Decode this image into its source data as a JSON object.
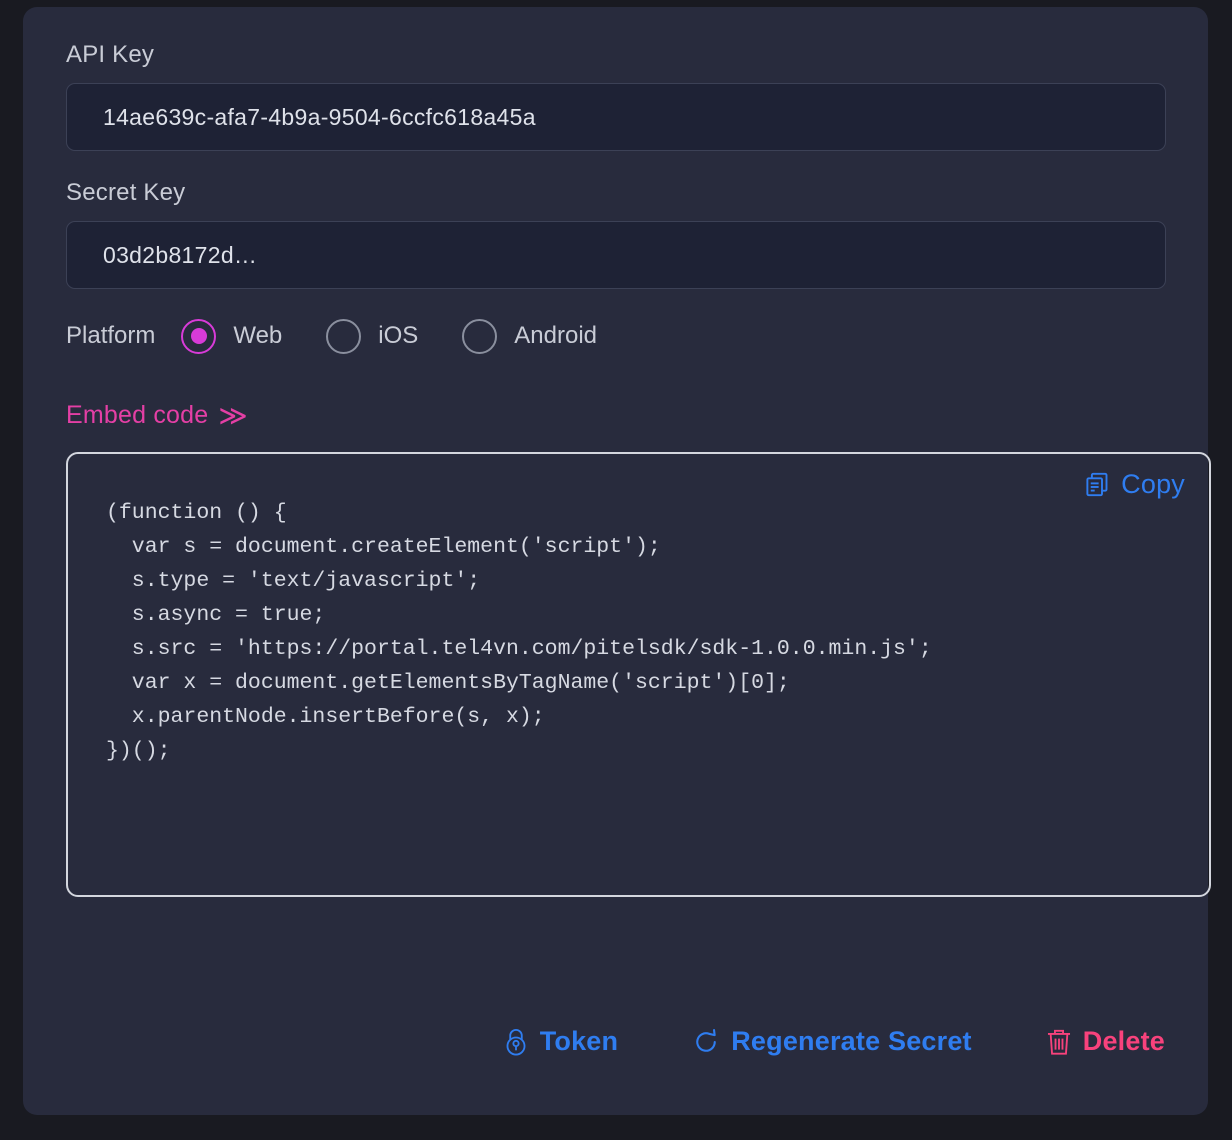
{
  "theme": {
    "page_background": "#191a21",
    "card_background": "#282b3d",
    "input_background": "#1e2235",
    "label_color": "#c9ccd6",
    "accent_magenta": "#d83bd8",
    "accent_pink_link": "#e43fa5",
    "accent_blue": "#2f7df0",
    "accent_danger": "#f8427c",
    "code_border": "#d3d6de"
  },
  "fields": {
    "api_key": {
      "label": "API Key",
      "value": "14ae639c-afa7-4b9a-9504-6ccfc618a45a"
    },
    "secret_key": {
      "label": "Secret Key",
      "value": "03d2b8172d…"
    }
  },
  "platform": {
    "label": "Platform",
    "selected": "Web",
    "options": [
      {
        "label": "Web",
        "selected": true
      },
      {
        "label": "iOS",
        "selected": false
      },
      {
        "label": "Android",
        "selected": false
      }
    ]
  },
  "embed": {
    "link_label": "Embed code",
    "chevron": "≫",
    "copy_label": "Copy",
    "code": "(function () {\n  var s = document.createElement('script');\n  s.type = 'text/javascript';\n  s.async = true;\n  s.src = 'https://portal.tel4vn.com/pitelsdk/sdk-1.0.0.min.js';\n  var x = document.getElementsByTagName('script')[0];\n  x.parentNode.insertBefore(s, x);\n})();"
  },
  "actions": [
    {
      "label": "Token",
      "icon": "lock-icon",
      "color": "#2f7df0"
    },
    {
      "label": "Regenerate Secret",
      "icon": "refresh-icon",
      "color": "#2f7df0"
    },
    {
      "label": "Delete",
      "icon": "trash-icon",
      "color": "#f8427c"
    }
  ]
}
